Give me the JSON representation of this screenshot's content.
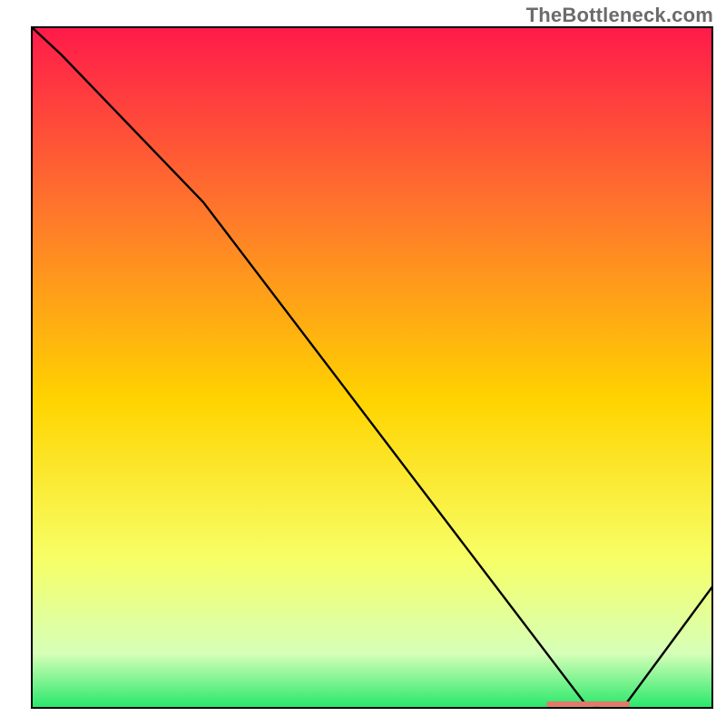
{
  "watermark": "TheBottleneck.com",
  "chart_data": {
    "type": "line",
    "title": "",
    "xlabel": "",
    "ylabel": "",
    "xlim": [
      0,
      100
    ],
    "ylim": [
      0,
      100
    ],
    "gradient_colors": {
      "top": "#ff1a4a",
      "upper_mid": "#ff7a2a",
      "mid": "#ffd400",
      "lower_mid": "#f7ff66",
      "lower": "#d6ffb8",
      "bottom": "#27e86a"
    },
    "x": [
      0,
      4.3,
      25.2,
      81.3,
      82.8,
      87.3,
      100
    ],
    "y": [
      100,
      96.0,
      74.3,
      0.6,
      0.3,
      0.6,
      17.8
    ],
    "marker_segment": {
      "x_start": 76.0,
      "x_end": 87.5,
      "y": 0.55,
      "color": "#e07a6a"
    },
    "annotations": []
  }
}
